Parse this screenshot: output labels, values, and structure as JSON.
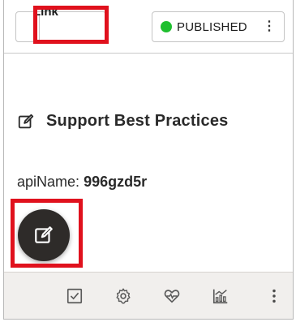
{
  "toolbar": {
    "link_label": "Link",
    "status_label": "PUBLISHED",
    "status_color": "#1fbf2f",
    "status_menu_icon": "kebab-vertical-icon"
  },
  "content": {
    "title": "Support Best Practices",
    "title_icon": "edit-icon",
    "api_label": "apiName:",
    "api_value": "996gzd5r"
  },
  "fab": {
    "icon": "edit-icon",
    "color": "#2e2b29"
  },
  "bottom_toolbar": {
    "icons": [
      "checkbox-icon",
      "gear-icon",
      "heart-pulse-icon",
      "chart-icon",
      "more-vertical-icon"
    ]
  },
  "highlight_color": "#e0111d"
}
